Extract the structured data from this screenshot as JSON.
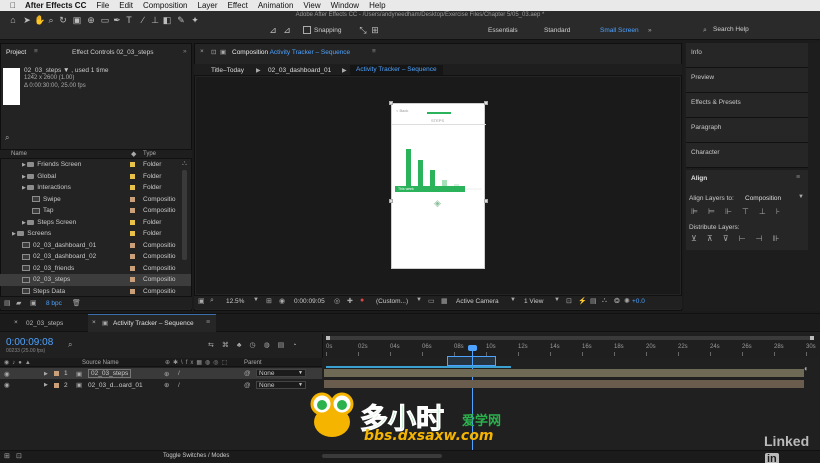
{
  "menubar": {
    "items": [
      "After Effects CC",
      "File",
      "Edit",
      "Composition",
      "Layer",
      "Effect",
      "Animation",
      "View",
      "Window",
      "Help"
    ]
  },
  "window_title": "Adobe After Effects CC - /Users/andyneedham/Desktop/Exercise Files/Chapter 5/05_03.aep *",
  "toolbar": {
    "snapping_label": "Snapping",
    "workspaces": [
      "Essentials",
      "Standard",
      "Small Screen"
    ],
    "active_workspace": "Small Screen",
    "search_placeholder": "Search Help"
  },
  "project_panel": {
    "tab_project": "Project",
    "tab_effect_controls": "Effect Controls 02_03_steps",
    "item_info_line1": "02_03_steps ▼ , used 1 time",
    "item_info_line2": "1242 x 2600 (1.00)",
    "item_info_line3": "Δ 0:00:30:00, 25.00 fps",
    "col_name": "Name",
    "col_type": "Type",
    "rows": [
      {
        "name": "Friends Screen",
        "type": "Folder",
        "kind": "folder",
        "indent": 1,
        "color": "#e8c14a"
      },
      {
        "name": "Global",
        "type": "Folder",
        "kind": "folder",
        "indent": 1,
        "color": "#e8c14a"
      },
      {
        "name": "Interactions",
        "type": "Folder",
        "kind": "folder",
        "indent": 1,
        "color": "#e8c14a"
      },
      {
        "name": "Swipe",
        "type": "Compositio",
        "kind": "comp",
        "indent": 2,
        "color": "#c9a07a"
      },
      {
        "name": "Tap",
        "type": "Compositio",
        "kind": "comp",
        "indent": 2,
        "color": "#c9a07a"
      },
      {
        "name": "Steps Screen",
        "type": "Folder",
        "kind": "folder",
        "indent": 1,
        "color": "#e8c14a"
      },
      {
        "name": "Screens",
        "type": "Folder",
        "kind": "folder",
        "indent": 0,
        "color": "#e8c14a"
      },
      {
        "name": "02_03_dashboard_01",
        "type": "Compositio",
        "kind": "comp",
        "indent": 1,
        "color": "#c9a07a"
      },
      {
        "name": "02_03_dashboard_02",
        "type": "Compositio",
        "kind": "comp",
        "indent": 1,
        "color": "#c9a07a"
      },
      {
        "name": "02_03_friends",
        "type": "Compositio",
        "kind": "comp",
        "indent": 1,
        "color": "#c9a07a"
      },
      {
        "name": "02_03_steps",
        "type": "Compositio",
        "kind": "comp",
        "indent": 1,
        "color": "#c9a07a",
        "selected": true
      },
      {
        "name": "Steps Data",
        "type": "Compositio",
        "kind": "comp",
        "indent": 1,
        "color": "#c9a07a"
      }
    ],
    "bpc_label": "8 bpc"
  },
  "composition_panel": {
    "tab_label": "Composition",
    "tab_comp_name": "Activity Tracker – Sequence",
    "breadcrumbs": [
      "Title–Today",
      "02_03_dashboard_01",
      "Activity Tracker – Sequence"
    ],
    "zoom": "12.5%",
    "timecode": "0:00:09:05",
    "resolution": "(Custom...)",
    "camera": "Active Camera",
    "views": "1 View",
    "exposure": "+0.0",
    "phone_header_left": "< Back",
    "phone_header_title": "STEPS",
    "phone_bar_label": "This week"
  },
  "right_panels": {
    "items": [
      "Info",
      "Preview",
      "Effects & Presets",
      "Paragraph",
      "Character"
    ],
    "align_title": "Align",
    "align_layers_to_label": "Align Layers to:",
    "align_layers_to_value": "Composition",
    "distribute_label": "Distribute Layers:"
  },
  "timeline": {
    "tabs": [
      "02_03_steps",
      "Activity Tracker – Sequence"
    ],
    "active_tab": "Activity Tracker – Sequence",
    "timecode": "0:00:09:08",
    "fps_line": "00233 (25.00 fps)",
    "col_source_name": "Source Name",
    "col_parent": "Parent",
    "ruler_labels": [
      "0s",
      "02s",
      "04s",
      "06s",
      "08s",
      "10s",
      "12s",
      "14s",
      "16s",
      "18s",
      "20s",
      "22s",
      "24s",
      "26s",
      "28s",
      "30s"
    ],
    "layers": [
      {
        "num": "1",
        "name": "02_03_steps",
        "parent": "None",
        "selected": true
      },
      {
        "num": "2",
        "name": "02_03_d...oard_01",
        "parent": "None",
        "selected": false
      }
    ],
    "footer_label": "Toggle Switches / Modes"
  },
  "watermark": {
    "brand_cn": "多小时",
    "brand_sub": "爱学网",
    "url": "bbs.dxsaxw.com"
  },
  "linkedin_label": "Linked"
}
